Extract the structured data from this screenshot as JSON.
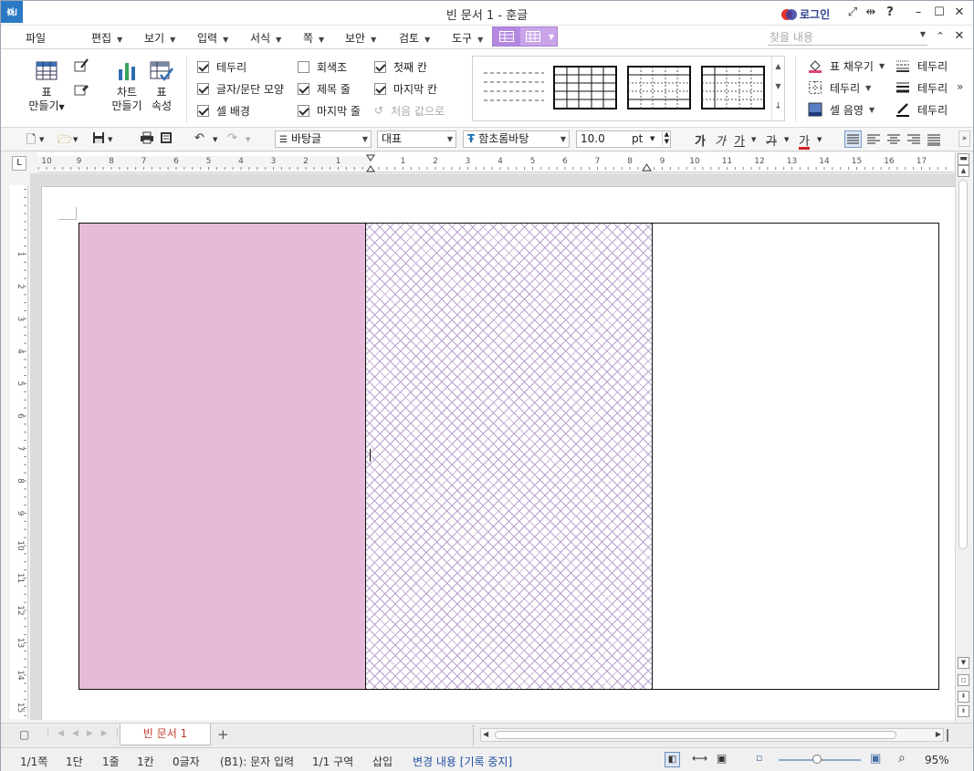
{
  "window": {
    "title": "빈 문서 1 - 훈글",
    "logo_text": "훈",
    "login_label": "로그인"
  },
  "menu": {
    "items": [
      {
        "label": "파일"
      },
      {
        "label": "편집"
      },
      {
        "label": "보기"
      },
      {
        "label": "입력"
      },
      {
        "label": "서식"
      },
      {
        "label": "쪽"
      },
      {
        "label": "보안"
      },
      {
        "label": "검토"
      },
      {
        "label": "도구"
      }
    ],
    "search_placeholder": "찾을 내용"
  },
  "ribbon": {
    "table_make_label": "표",
    "table_make_label2": "만들기",
    "chart_make_label": "차트",
    "chart_make_label2": "만들기",
    "table_props_label": "표",
    "table_props_label2": "속성",
    "checkboxes": [
      {
        "label": "테두리",
        "checked": true
      },
      {
        "label": "글자/문단 모양",
        "checked": true
      },
      {
        "label": "셀 배경",
        "checked": true
      },
      {
        "label": "회색조",
        "checked": false
      },
      {
        "label": "제목 줄",
        "checked": true
      },
      {
        "label": "마지막 줄",
        "checked": true
      },
      {
        "label": "첫째 칸",
        "checked": true
      },
      {
        "label": "마지막 칸",
        "checked": true
      }
    ],
    "reset_label": "처음 값으로",
    "right_items": [
      {
        "label": "표 채우기"
      },
      {
        "label": "테두리"
      },
      {
        "label": "셀 음영"
      },
      {
        "label": "테두리"
      },
      {
        "label": "테두리"
      },
      {
        "label": "테두리"
      }
    ]
  },
  "format": {
    "style": "바탕글",
    "lang": "대표",
    "font": "함초롬바탕",
    "size": "10.0",
    "unit": "pt",
    "bold": "가",
    "italic": "가",
    "underline": "가",
    "strike": "가",
    "color": "가"
  },
  "ruler": {
    "h_left_labels": [
      "10",
      "9",
      "8",
      "7",
      "6",
      "5",
      "4",
      "3",
      "2",
      "1"
    ],
    "h_right_labels": [
      "1",
      "2",
      "3",
      "4",
      "5",
      "6",
      "7",
      "8",
      "9",
      "10",
      "11",
      "12",
      "13",
      "14",
      "15",
      "16",
      "17"
    ],
    "v_labels": [
      "1",
      "2",
      "3",
      "4",
      "5",
      "6",
      "7",
      "8",
      "9",
      "10",
      "11",
      "12",
      "13",
      "14",
      "15",
      "16"
    ]
  },
  "tabs": {
    "doc_tab": "빈 문서 1",
    "add": "+"
  },
  "status": {
    "page": "1/1쪽",
    "column": "1단",
    "line": "1줄",
    "cell_col": "1칸",
    "chars": "0글자",
    "cell_mode": "(B1): 문자 입력",
    "section": "1/1 구역",
    "insert": "삽입",
    "track": "변경 내용 [기록 중지]",
    "zoom": "95%"
  },
  "colors": {
    "cell1_fill": "#e6bbd9",
    "cell2_hatch": "#b9a3cc",
    "tools_tab": "#c9a4e8",
    "brand": "#2a79c4"
  }
}
